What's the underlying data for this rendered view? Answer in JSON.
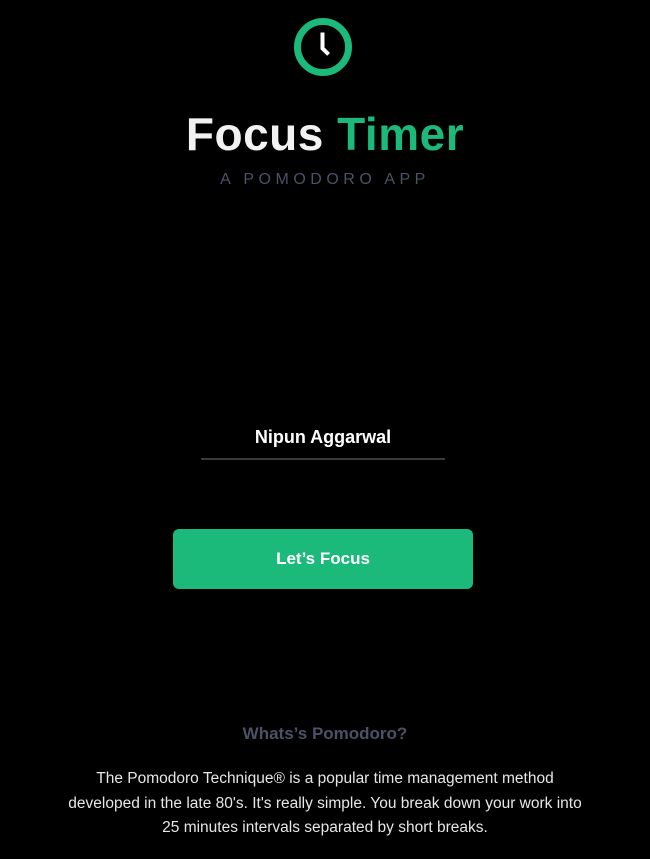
{
  "app": {
    "logo_icon": "clock-icon",
    "title_part1": "Focus",
    "title_part2": "Timer",
    "subtitle": "A POMODORO APP"
  },
  "form": {
    "name_value": "Nipun Aggarwal",
    "submit_label": "Let’s Focus"
  },
  "info": {
    "heading": "Whats’s Pomodoro?",
    "paragraph": "The Pomodoro Technique® is a popular time management method developed in the late 80's. It's really simple. You break down your work into 25 minutes intervals separated by short breaks."
  },
  "colors": {
    "background": "#000000",
    "accent": "#1bb97a",
    "muted": "#4b5266",
    "text": "#ffffff"
  }
}
